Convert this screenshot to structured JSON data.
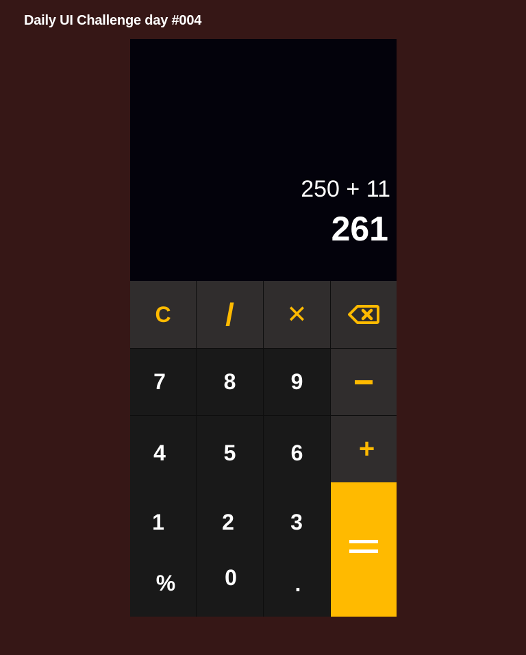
{
  "header": {
    "title": "Daily UI Challenge day #004"
  },
  "display": {
    "expression": "250 + 11",
    "result": "261"
  },
  "keys": {
    "clear": "C",
    "divide": "/",
    "multiply": "✕",
    "backspace_icon": "backspace-icon",
    "seven": "7",
    "eight": "8",
    "nine": "9",
    "minus_icon": "minus-icon",
    "four": "4",
    "five": "5",
    "six": "6",
    "plus": "+",
    "one": "1",
    "two": "2",
    "three": "3",
    "percent": "%",
    "zero": "0",
    "dot": ".",
    "equals_icon": "equals-icon"
  },
  "colors": {
    "background": "#361716",
    "display_bg": "#03020b",
    "operator_bg": "#302d2d",
    "number_bg": "#191919",
    "accent": "#ffba00",
    "text": "#ffffff"
  }
}
